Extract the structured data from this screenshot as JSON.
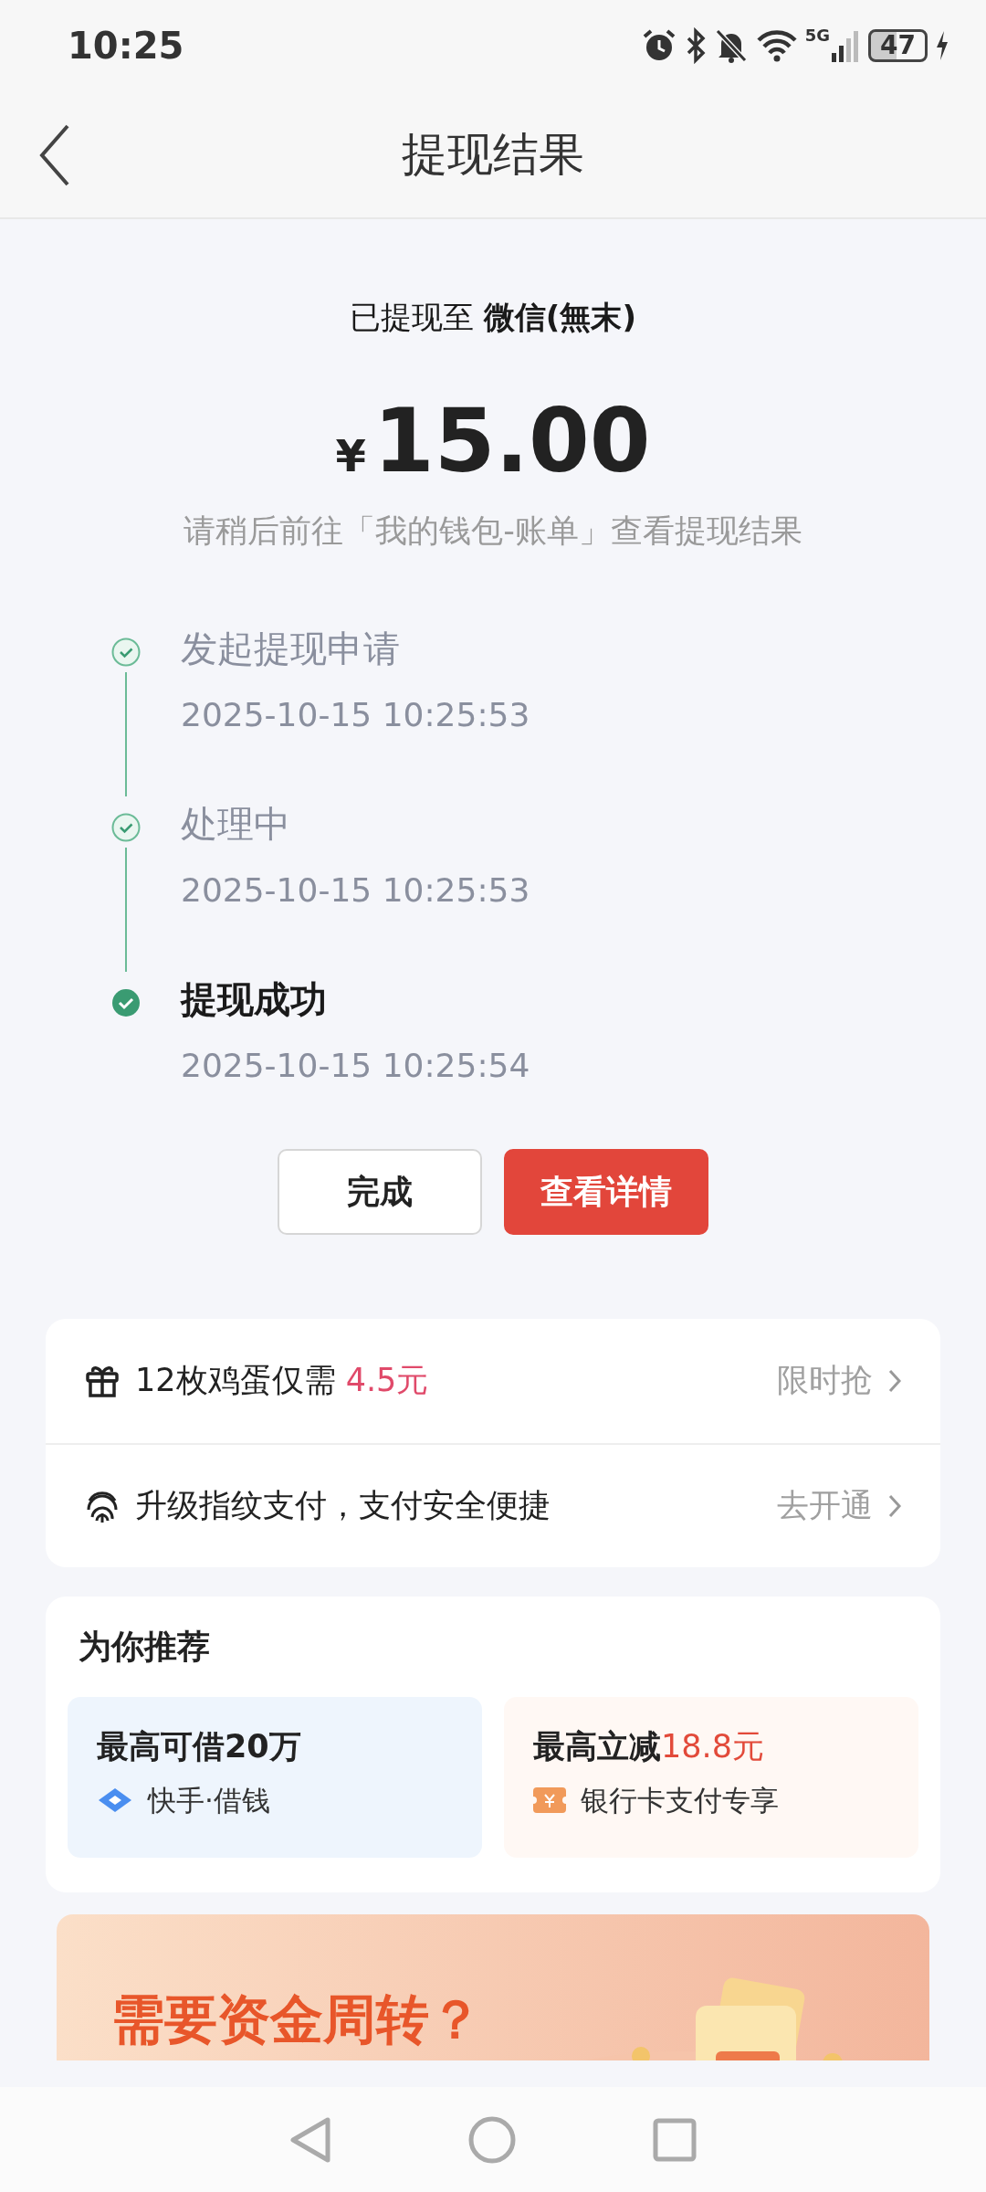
{
  "status_bar": {
    "time": "10:25",
    "network": "5G",
    "battery": "47",
    "charging": true
  },
  "header": {
    "title": "提现结果"
  },
  "result": {
    "destination_label": "已提现至",
    "destination": "微信(無末)",
    "currency": "¥",
    "amount": "15.00",
    "hint": "请稍后前往「我的钱包-账单」查看提现结果"
  },
  "timeline": [
    {
      "title": "发起提现申请",
      "time": "2025-10-15 10:25:53",
      "current": false
    },
    {
      "title": "处理中",
      "time": "2025-10-15 10:25:53",
      "current": false
    },
    {
      "title": "提现成功",
      "time": "2025-10-15 10:25:54",
      "current": true
    }
  ],
  "buttons": [
    {
      "label": "完成",
      "kind": "secondary"
    },
    {
      "label": "查看详情",
      "kind": "primary"
    }
  ],
  "promos": [
    {
      "kind": "gift",
      "text": "12枚鸡蛋仅需",
      "highlight": "4.5元",
      "action": "限时抢"
    },
    {
      "kind": "fingerprint",
      "text": "升级指纹支付，支付安全便捷",
      "action": "去开通"
    }
  ],
  "recommend": {
    "title": "为你推荐",
    "tiles": [
      {
        "kind": "loan",
        "headline": "最高可借20万",
        "sub": "快手·借钱"
      },
      {
        "kind": "coupon",
        "headline": "最高立减",
        "highlight": "18.8元",
        "sub": "银行卡支付专享"
      }
    ]
  },
  "banner": {
    "title": "需要资金周转？"
  }
}
